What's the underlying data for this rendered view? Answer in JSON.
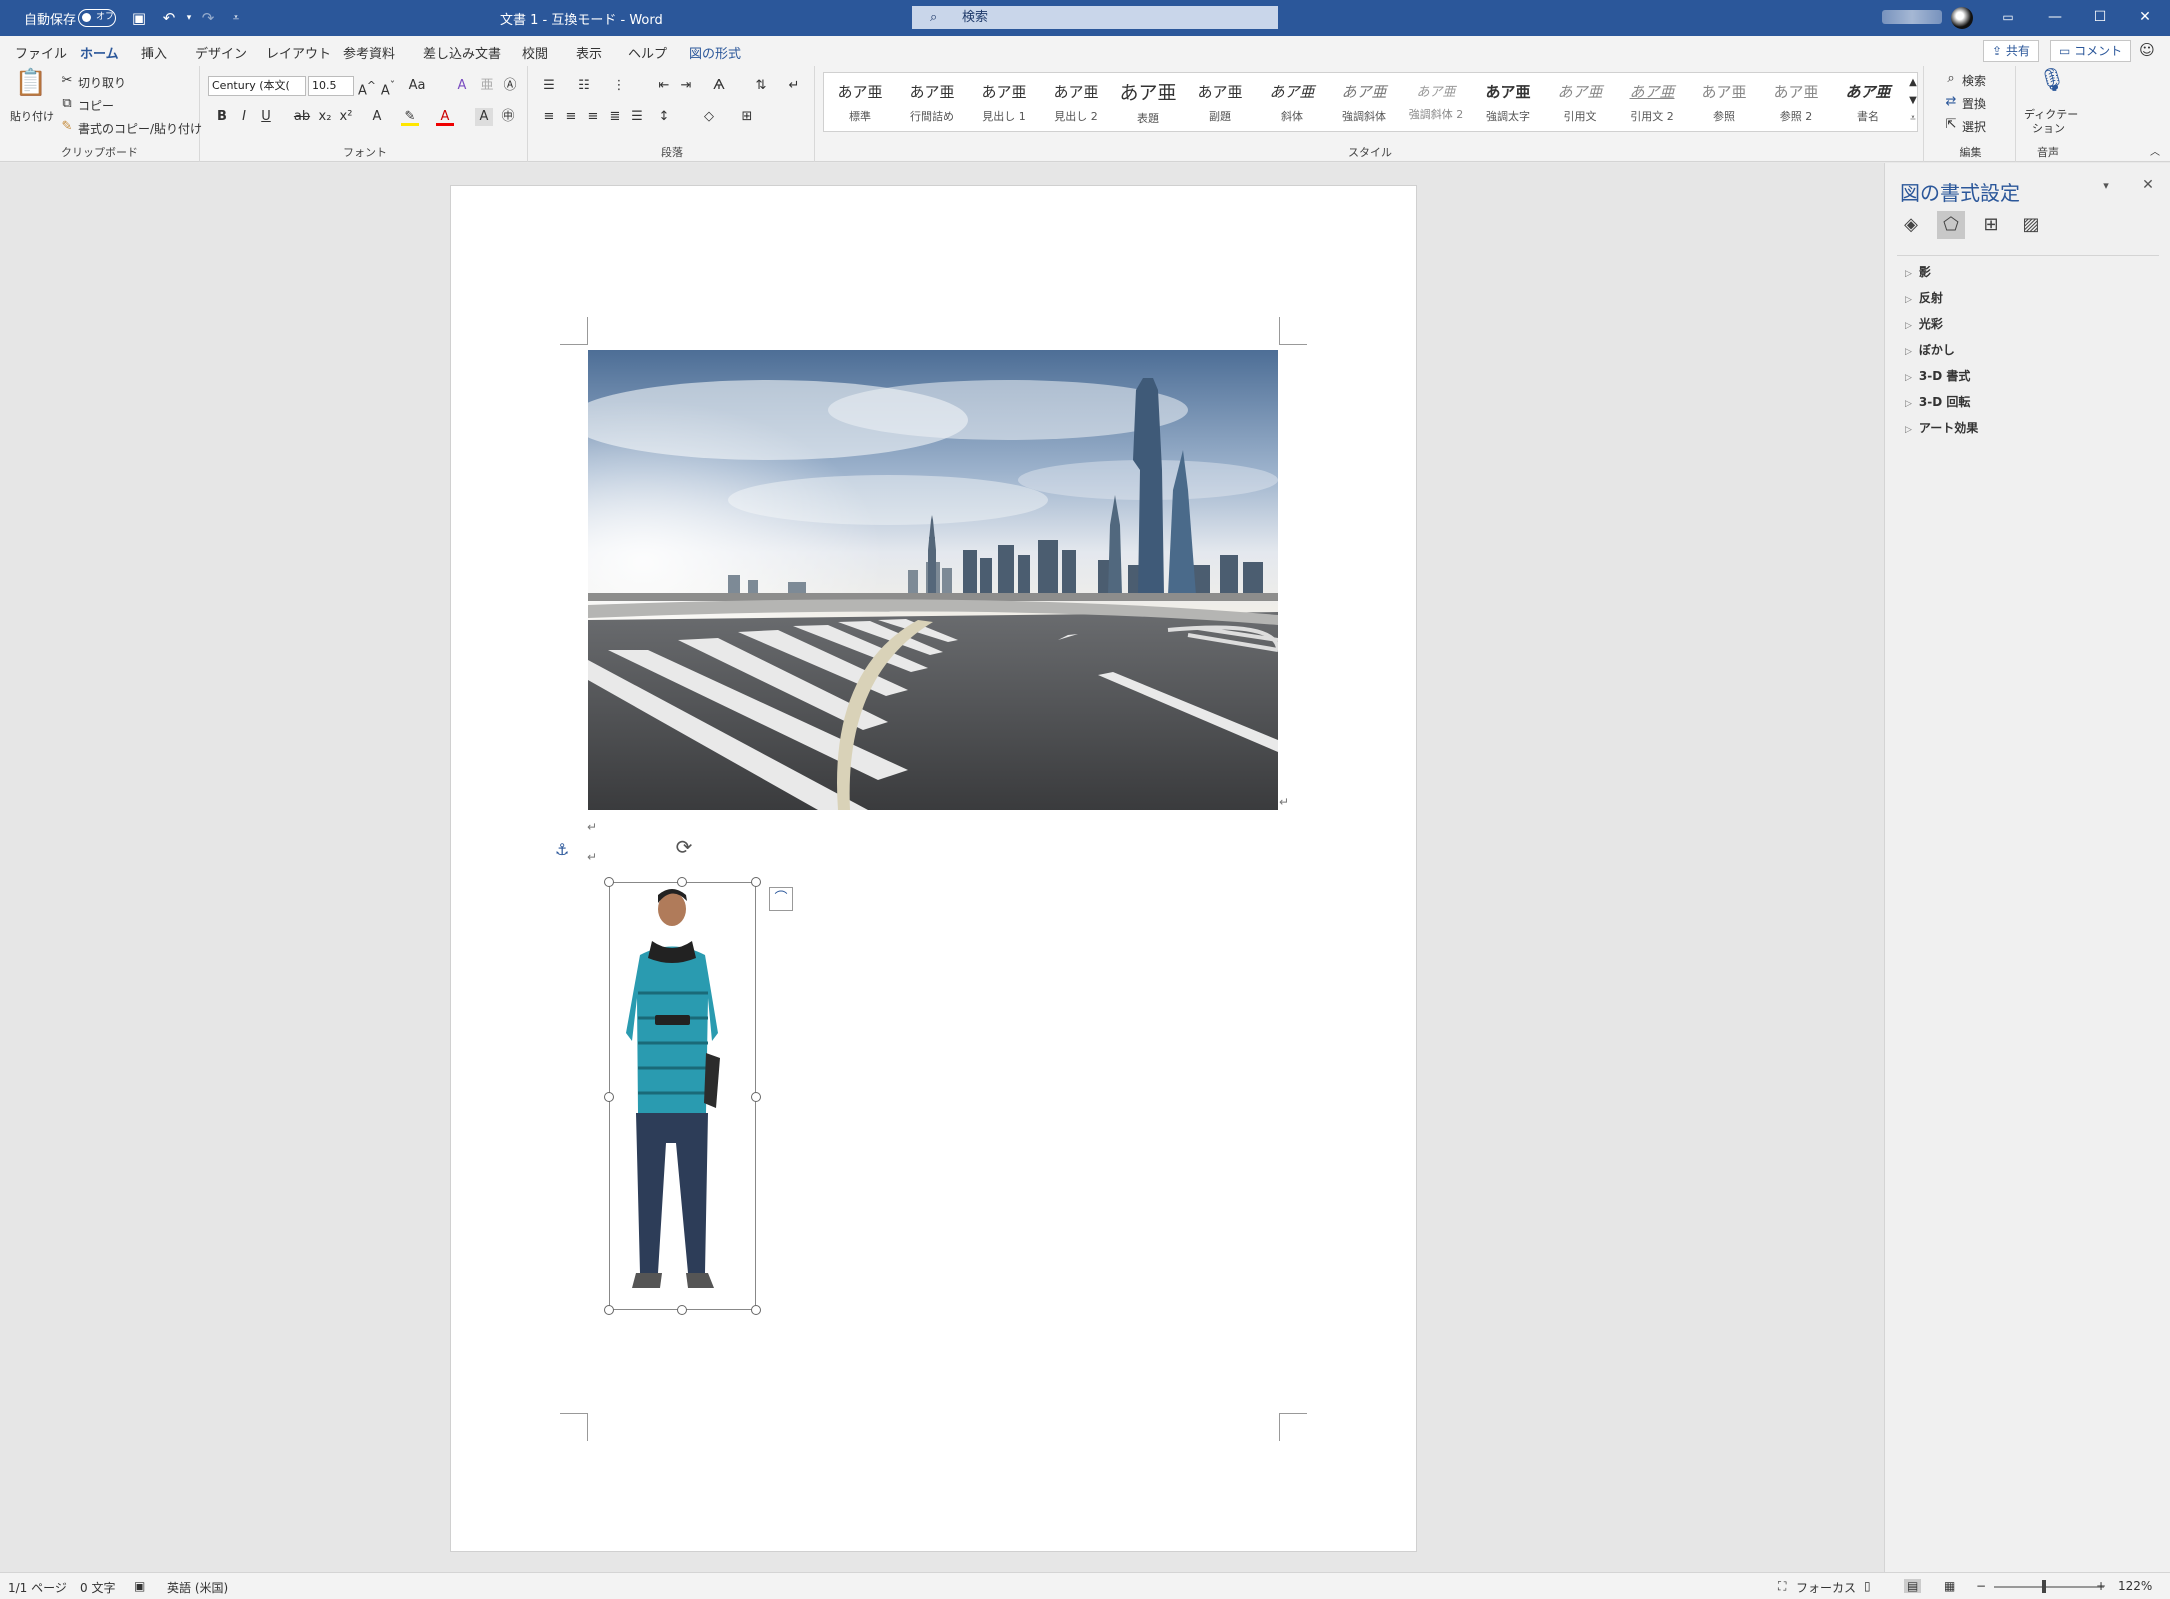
{
  "titlebar": {
    "autosave_label": "自動保存",
    "autosave_state": "オフ",
    "doc_title": "文書 1  -  互換モード  -  Word",
    "search_placeholder": "検索",
    "save_icon": "save-icon",
    "undo_icon": "undo-icon",
    "redo_icon": "redo-icon"
  },
  "tabs": [
    "ファイル",
    "ホーム",
    "挿入",
    "デザイン",
    "レイアウト",
    "参考資料",
    "差し込み文書",
    "校閲",
    "表示",
    "ヘルプ",
    "図の形式"
  ],
  "active_tab": "ホーム",
  "header_buttons": {
    "share": "共有",
    "comment": "コメント"
  },
  "clipboard": {
    "paste": "貼り付け",
    "cut": "切り取り",
    "copy": "コピー",
    "format_painter": "書式のコピー/貼り付け",
    "group": "クリップボード"
  },
  "font": {
    "name": "Century (本文(",
    "size": "10.5",
    "group": "フォント"
  },
  "paragraph": {
    "group": "段落"
  },
  "styles": {
    "group": "スタイル",
    "preview": "あア亜",
    "items": [
      "標準",
      "行間詰め",
      "見出し 1",
      "見出し 2",
      "表題",
      "副題",
      "斜体",
      "強調斜体",
      "強調斜体 2",
      "強調太字",
      "引用文",
      "引用文 2",
      "参照",
      "参照 2",
      "書名"
    ]
  },
  "editing": {
    "find": "検索",
    "replace": "置換",
    "select": "選択",
    "group": "編集"
  },
  "voice": {
    "dictate": "ディクテー",
    "dictate2": "ション",
    "group": "音声"
  },
  "pane": {
    "title": "図の書式設定",
    "items": [
      "影",
      "反射",
      "光彩",
      "ぼかし",
      "3-D 書式",
      "3-D 回転",
      "アート効果"
    ]
  },
  "status": {
    "page": "1/1 ページ",
    "words": "0 文字",
    "language": "英語 (米国)",
    "focus": "フォーカス",
    "zoom": "122%"
  }
}
